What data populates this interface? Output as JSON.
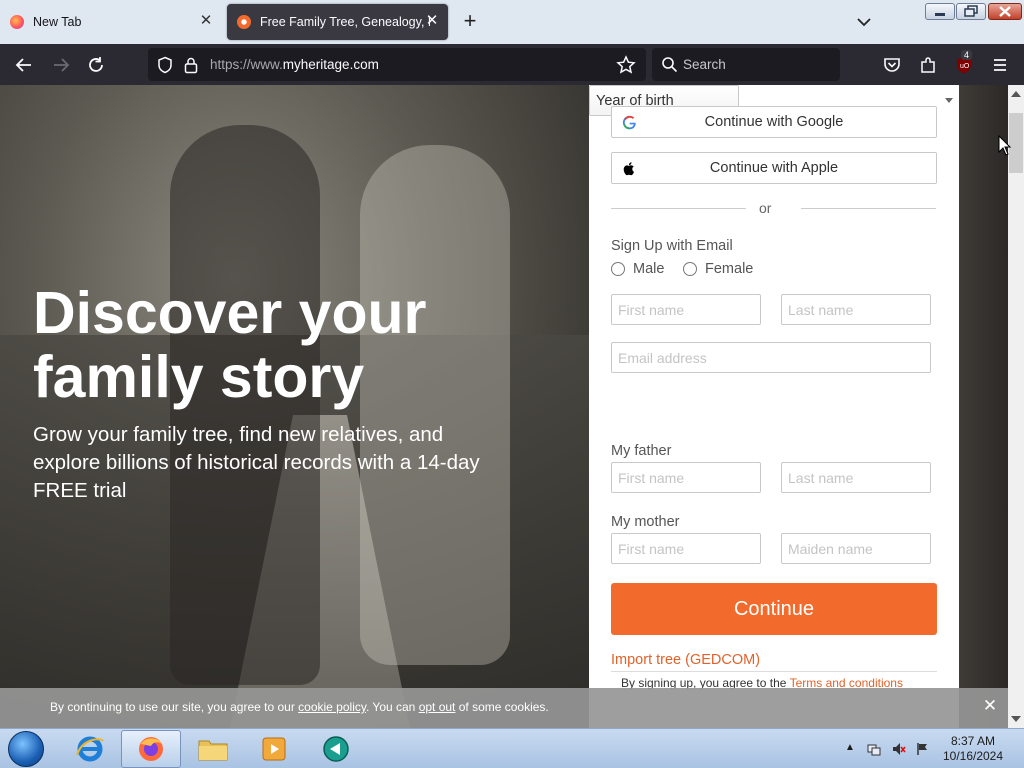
{
  "browser": {
    "tabs": [
      {
        "title": "New Tab",
        "active": false
      },
      {
        "title": "Free Family Tree, Genealogy, Fa",
        "active": true
      }
    ],
    "url_prefix": "https://www.",
    "url_domain": "myheritage.com",
    "search_placeholder": "Search",
    "extension_badge": "4"
  },
  "hero": {
    "title": "Discover your family story",
    "subtitle": "Grow your family tree, find new relatives, and explore billions of historical records with a 14-day FREE trial"
  },
  "signup": {
    "google_label": "Continue with Google",
    "apple_label": "Continue with Apple",
    "or_text": "or",
    "email_section_label": "Sign Up with Email",
    "gender_options": [
      "Male",
      "Female"
    ],
    "first_name_placeholder": "First name",
    "last_name_placeholder": "Last name",
    "email_placeholder": "Email address",
    "year_of_birth": "Year of birth",
    "father_label": "My father",
    "father_first_placeholder": "First name",
    "father_last_placeholder": "Last name",
    "mother_label": "My mother",
    "mother_first_placeholder": "First name",
    "mother_maiden_placeholder": "Maiden name",
    "continue_label": "Continue",
    "import_link": "Import tree (GEDCOM)",
    "terms_prefix": "By signing up, you agree to the ",
    "terms_link": "Terms and conditions"
  },
  "cookie": {
    "text_1": "By continuing to use our site, you agree to our ",
    "cookie_policy": "cookie policy",
    "text_2": ". You can ",
    "opt_out": "opt out",
    "text_3": " of some cookies."
  },
  "taskbar": {
    "time": "8:37 AM",
    "date": "10/16/2024"
  },
  "colors": {
    "accent": "#f26b2d",
    "link": "#e2622a",
    "toolbar": "#2b2a33"
  }
}
